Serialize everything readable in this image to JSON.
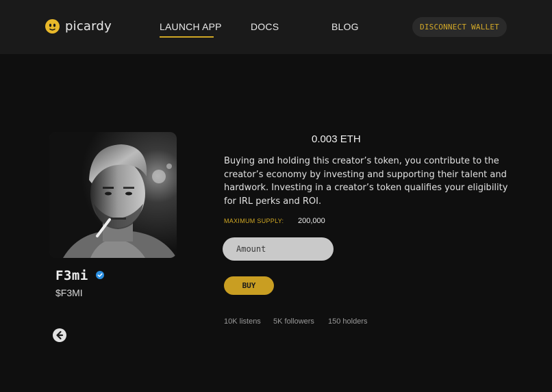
{
  "header": {
    "logo_text": "picardy",
    "nav": [
      "LAUNCH APP",
      "DOCS",
      "BLOG"
    ],
    "disconnect_label": "DISCONNECT WALLET"
  },
  "creator": {
    "name": "F3mi",
    "ticker": "$F3MI",
    "verified": true
  },
  "token": {
    "price": "0.003 ETH",
    "description": "Buying and holding this creator’s token, you contribute to the creator’s economy by investing and supporting their talent and hardwork. Investing in a creator’s token qualifies your eligibility for IRL perks and ROI.",
    "supply_label": "MAXIMUM SUPPLY:",
    "supply_value": "200,000",
    "amount_placeholder": "Amount",
    "buy_label": "BUY"
  },
  "stats": {
    "listens": "10K listens",
    "followers": "5K followers",
    "holders": "150 holders"
  },
  "colors": {
    "accent": "#d0a824",
    "background": "#0f0f0f",
    "header": "#1a1a1a",
    "verified": "#2a8ee0"
  },
  "icons": [
    "picardy-logo-icon",
    "verified-badge-icon",
    "back-arrow-icon"
  ]
}
